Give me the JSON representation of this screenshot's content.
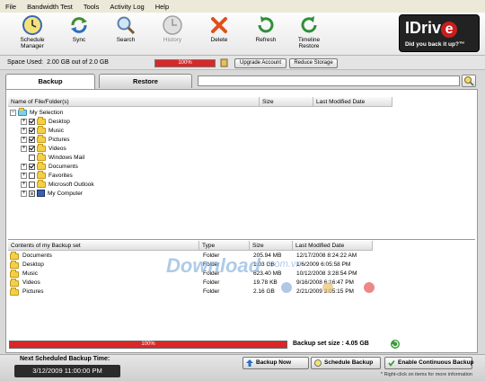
{
  "menu": [
    "File",
    "Bandwidth Test",
    "Tools",
    "Activity Log",
    "Help"
  ],
  "toolbar": {
    "schedule_manager": "Schedule\nManager",
    "sync": "Sync",
    "search": "Search",
    "history": "History",
    "delete": "Delete",
    "refresh": "Refresh",
    "timeline_restore": "Timeline\nRestore"
  },
  "brand": {
    "name": "IDriv",
    "e": "e",
    "tagline": "Did you back it up?™"
  },
  "space": {
    "label": "Space Used:",
    "value": "2.00 GB out of 2.0 GB",
    "progress_text": "100%",
    "progress": 1.0,
    "upgrade": "Upgrade Account",
    "reduce": "Reduce Storage"
  },
  "tabs": {
    "backup": "Backup",
    "restore": "Restore"
  },
  "search": {
    "placeholder": ""
  },
  "tree_headers": {
    "name": "Name of File/Folder(s)",
    "size": "Size",
    "modified": "Last Modified Date"
  },
  "tree": {
    "root": "My Selection",
    "items": [
      {
        "label": "Desktop",
        "checked": true,
        "expandable": true
      },
      {
        "label": "Music",
        "checked": true,
        "expandable": true
      },
      {
        "label": "Pictures",
        "checked": true,
        "expandable": true
      },
      {
        "label": "Videos",
        "checked": true,
        "expandable": true
      },
      {
        "label": "Windows Mail",
        "checked": false,
        "expandable": false
      },
      {
        "label": "Documents",
        "checked": true,
        "expandable": true
      },
      {
        "label": "Favorites",
        "checked": false,
        "expandable": true
      },
      {
        "label": "Microsoft Outlook",
        "checked": false,
        "expandable": true
      },
      {
        "label": "My Computer",
        "checked": "partial",
        "expandable": true
      }
    ]
  },
  "backupset_headers": {
    "contents": "Contents of my Backup set",
    "type": "Type",
    "size": "Size",
    "modified": "Last Modified Date"
  },
  "backupset": [
    {
      "name": "Documents",
      "type": "Folder",
      "size": "205.94 MB",
      "modified": "12/17/2008 8:24:22 AM"
    },
    {
      "name": "Desktop",
      "type": "Folder",
      "size": "1.03 GB",
      "modified": "1/6/2009 6:05:58 PM"
    },
    {
      "name": "Music",
      "type": "Folder",
      "size": "623.40 MB",
      "modified": "10/12/2008 3:28:54 PM"
    },
    {
      "name": "Videos",
      "type": "Folder",
      "size": "19.78 KB",
      "modified": "9/16/2008 6:16:47 PM"
    },
    {
      "name": "Pictures",
      "type": "Folder",
      "size": "2.16 GB",
      "modified": "2/21/2009 3:05:15 PM"
    }
  ],
  "watermark": {
    "main": "Download",
    "suffix": ".com.vn"
  },
  "bottom": {
    "progress_text": "100%",
    "progress": 1.0,
    "set_size": "Backup set size : 4.05 GB"
  },
  "footer": {
    "next_label": "Next Scheduled Backup Time:",
    "next_value": "3/12/2009 11:00:00 PM",
    "backup_now": "Backup Now",
    "schedule_backup": "Schedule Backup",
    "continuous": "Enable Continuous Backup",
    "hint": "* Right-click on items for more information"
  },
  "colors": {
    "accent_red": "#d82828",
    "brand_bg": "#222222"
  }
}
